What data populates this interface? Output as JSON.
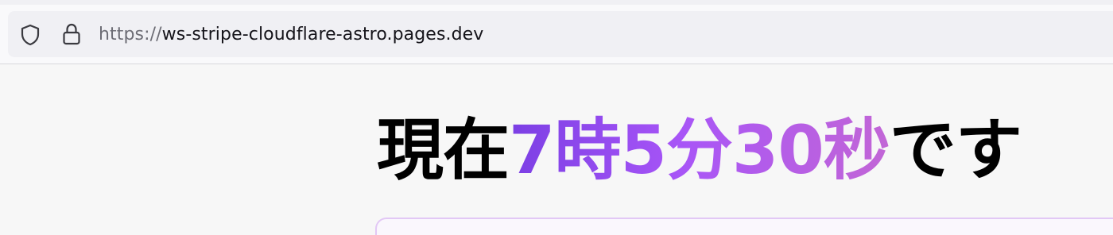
{
  "browser": {
    "url_scheme": "https://",
    "url_host": "ws-stripe-cloudflare-astro.pages.dev",
    "icons": {
      "tracking_protection": "shield-icon",
      "connection_secure": "lock-icon"
    }
  },
  "main": {
    "heading": {
      "prefix": "現在",
      "time": "7時5分30秒",
      "suffix": "です"
    },
    "colors": {
      "gradient_start": "#7b3fe4",
      "gradient_mid": "#a855f7",
      "gradient_end": "#c266d6",
      "card_border": "#e2c8f5"
    }
  }
}
